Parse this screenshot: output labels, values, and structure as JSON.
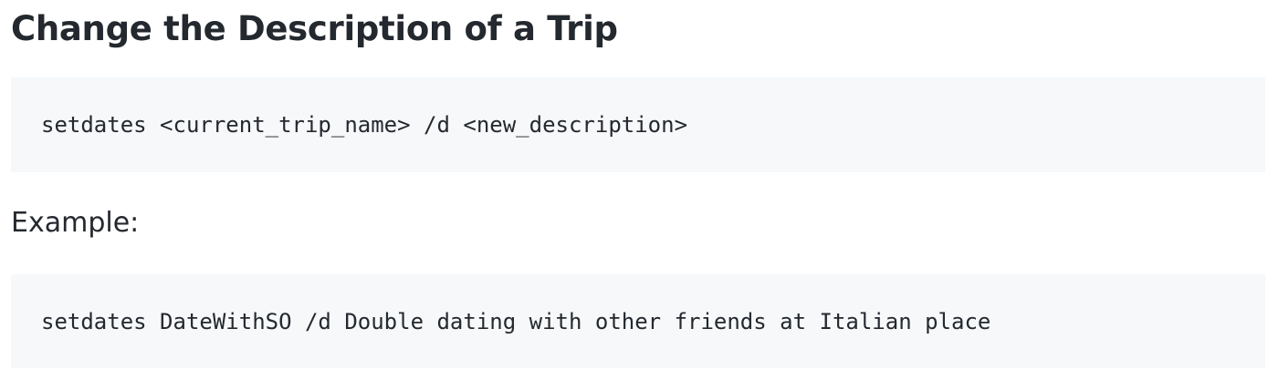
{
  "section": {
    "title": "Change the Description of a Trip"
  },
  "syntax": {
    "code": "setdates <current_trip_name> /d <new_description>"
  },
  "example": {
    "label": "Example:",
    "code": "setdates DateWithSO /d Double dating with other friends at Italian place"
  },
  "colors": {
    "text": "#24292f",
    "code_background": "#f6f8fa",
    "page_background": "#ffffff"
  }
}
